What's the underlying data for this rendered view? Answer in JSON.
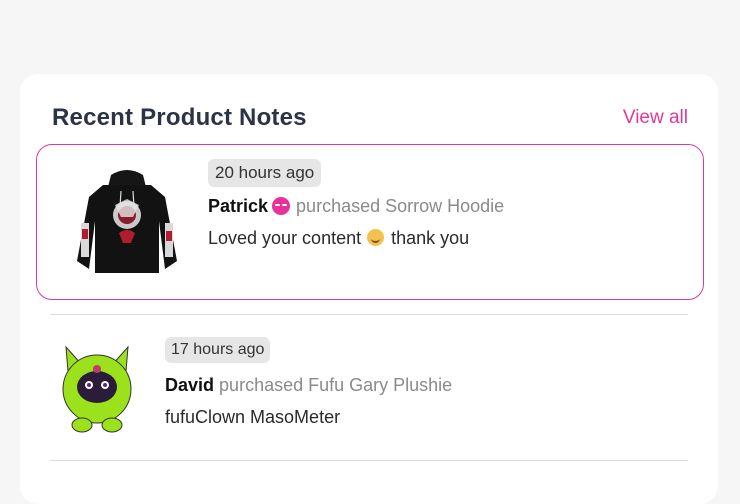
{
  "header": {
    "title": "Recent Product Notes",
    "view_all_label": "View all"
  },
  "notes": [
    {
      "time": "20 hours ago",
      "name": "Patrick",
      "name_emoji": "blushing-face-emoji",
      "action": "purchased Sorrow Hoodie",
      "message_part1": "Loved your content",
      "message_emoji": "smiling-face-emoji",
      "message_part2": "thank you",
      "product_image": "black-hoodie-image",
      "highlighted": true
    },
    {
      "time": "17 hours ago",
      "name": "David",
      "action": "purchased Fufu Gary Plushie",
      "message": "fufuClown MasoMeter",
      "product_image": "green-cat-plushie-image",
      "highlighted": false
    }
  ],
  "colors": {
    "accent": "#e0389a",
    "title": "#2c3345",
    "muted": "#8a8a8a",
    "badge_bg": "#e6e6e6",
    "background": "#f6f6f6",
    "card": "#ffffff"
  }
}
